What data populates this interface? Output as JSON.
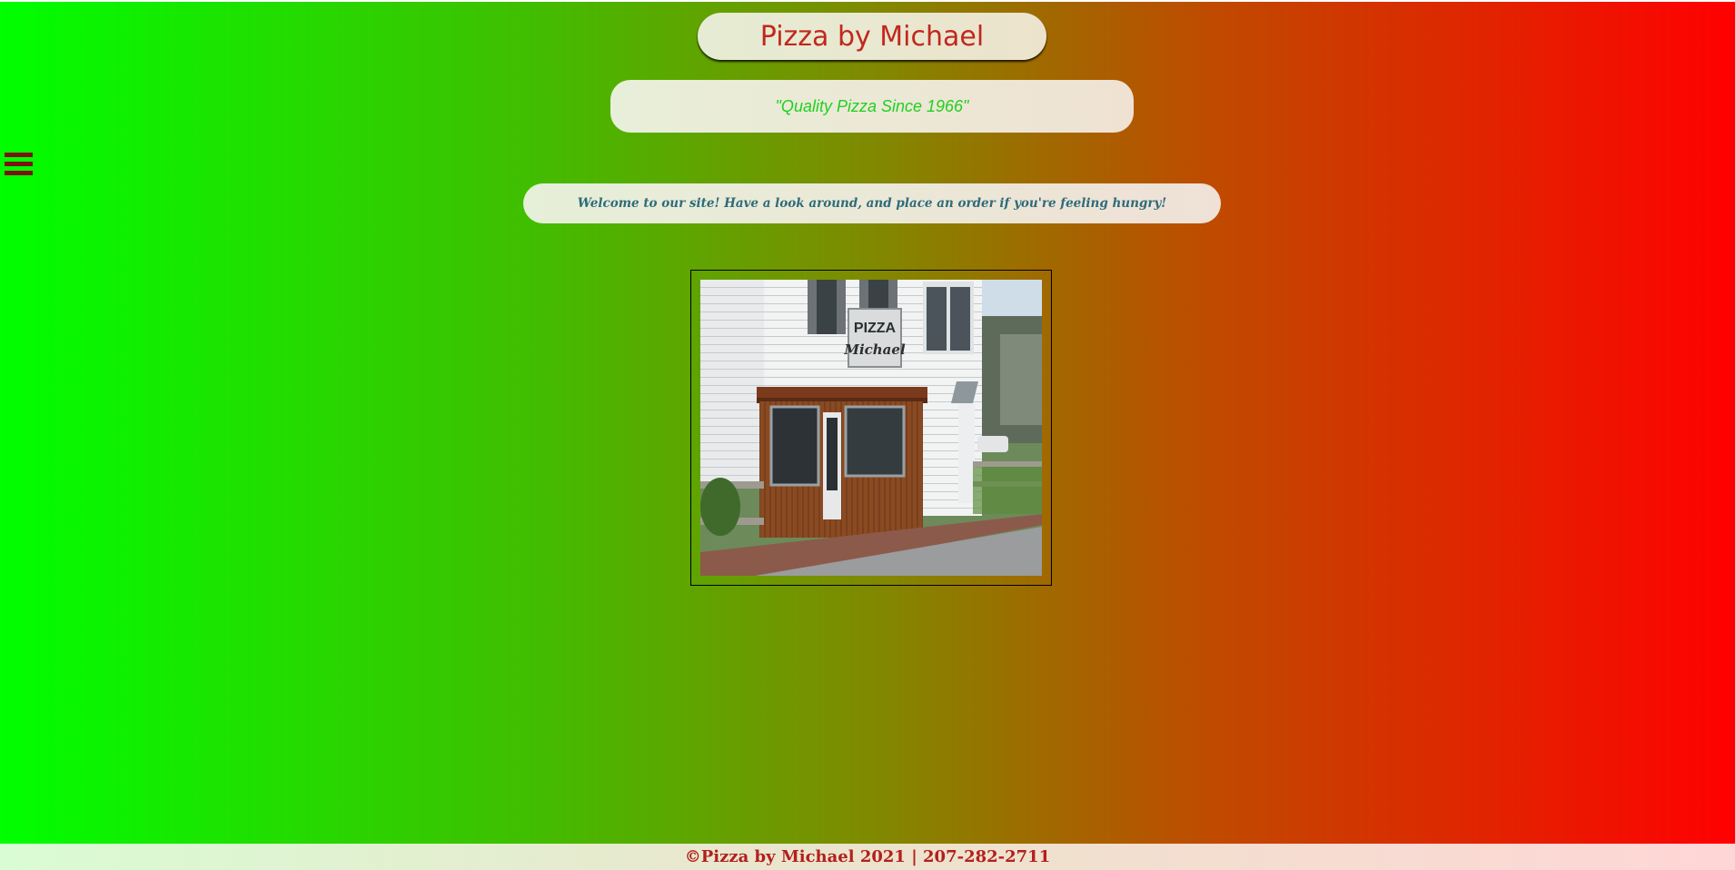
{
  "header": {
    "title": "Pizza by Michael",
    "tagline": "\"Quality Pizza Since 1966\""
  },
  "nav": {
    "menu_icon": "hamburger-menu-icon"
  },
  "main": {
    "welcome": "Welcome to our site! Have a look around, and place an order if you're feeling hungry!",
    "storefront_sign_line1": "PIZZA",
    "storefront_sign_line2": "Michael"
  },
  "footer": {
    "text": "©Pizza by Michael 2021 | 207-282-2711"
  },
  "colors": {
    "gradient_left": "#00ff00",
    "gradient_right": "#ff0000",
    "title_text": "#c0281e",
    "tagline_text": "#1fd01f",
    "welcome_text": "#2e6b7a",
    "footer_text": "#b2201c",
    "menu_icon": "#7a1410"
  }
}
